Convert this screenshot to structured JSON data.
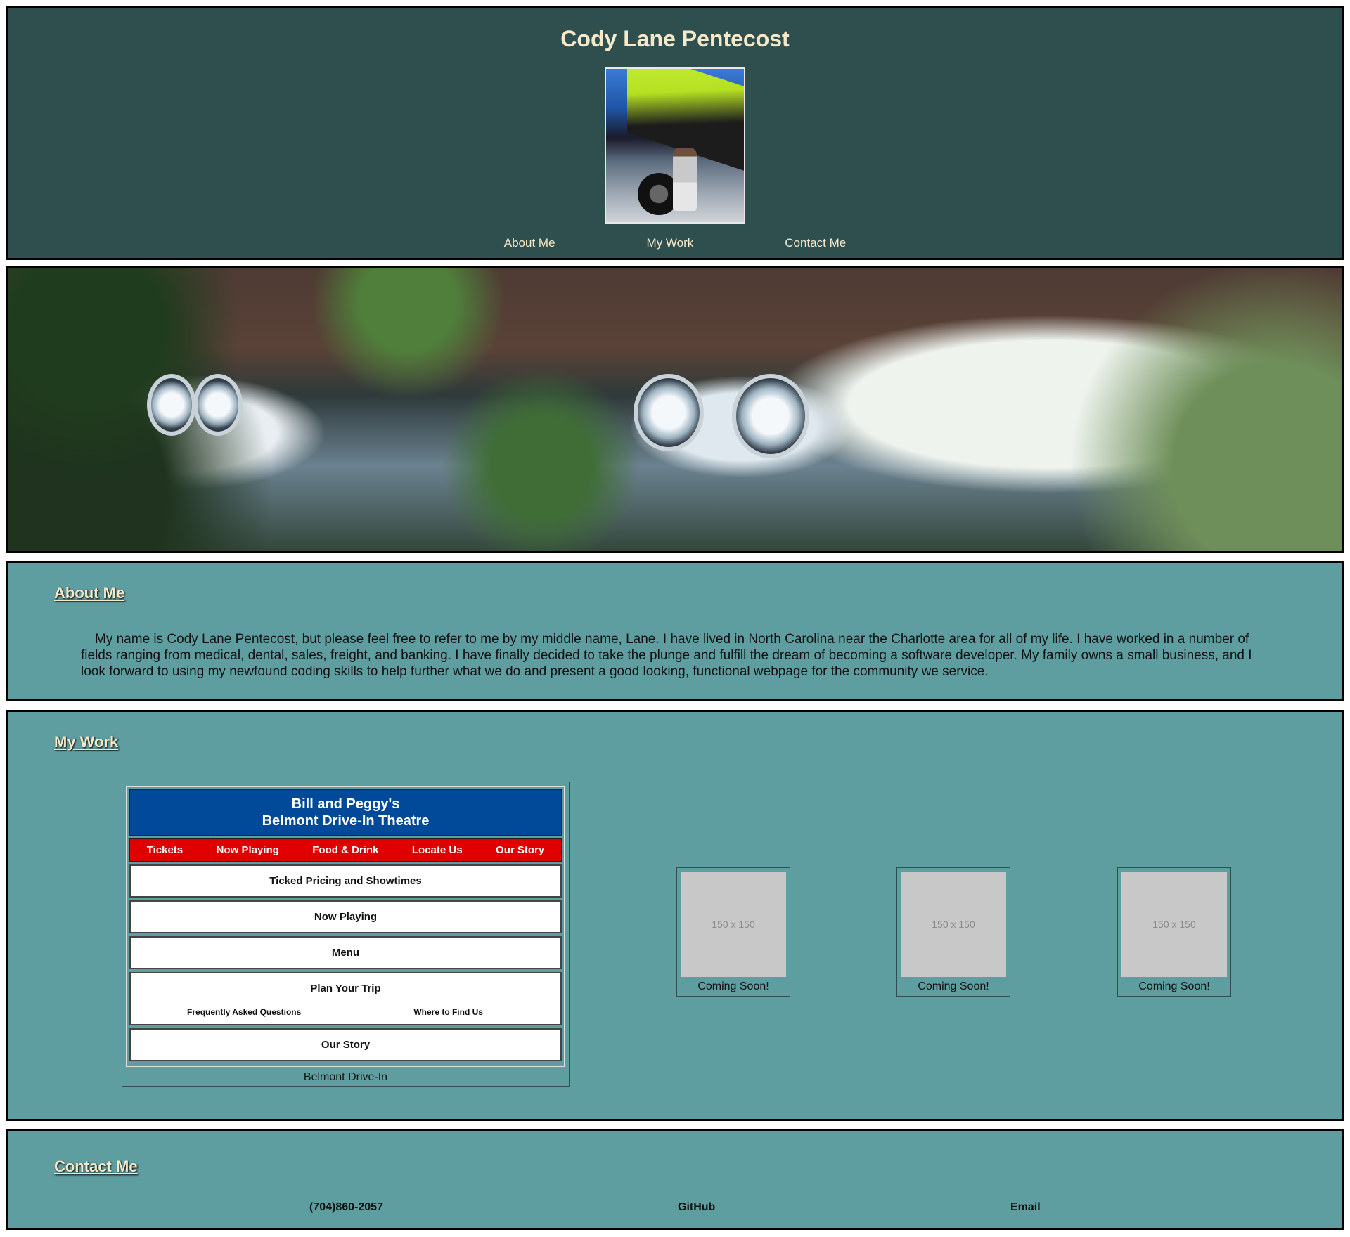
{
  "header": {
    "title": "Cody Lane Pentecost",
    "nav": [
      "About Me",
      "My Work",
      "Contact Me"
    ]
  },
  "about": {
    "heading": "About Me",
    "body": "My name is Cody Lane Pentecost, but please feel free to refer to me by my middle name, Lane. I have lived in North Carolina near the Charlotte area for all of my life. I have worked in a number of fields ranging from medical, dental, sales, freight, and banking. I have finally decided to take the plunge and fulfill the dream of becoming a software developer. My family owns a small business, and I look forward to using my newfound coding skills to help further what we do and present a good looking, functional webpage for the community we service."
  },
  "work": {
    "heading": "My Work",
    "project": {
      "title_line1": "Bill and Peggy's",
      "title_line2": "Belmont Drive-In Theatre",
      "nav": [
        "Tickets",
        "Now Playing",
        "Food & Drink",
        "Locate Us",
        "Our Story"
      ],
      "boxes": [
        "Ticked Pricing and Showtimes",
        "Now Playing",
        "Menu",
        "Plan Your Trip",
        "Our Story"
      ],
      "sub_links": [
        "Frequently Asked Questions",
        "Where to Find Us"
      ],
      "caption": "Belmont Drive-In"
    },
    "placeholders": [
      {
        "label": "150 x 150",
        "caption": "Coming Soon!"
      },
      {
        "label": "150 x 150",
        "caption": "Coming Soon!"
      },
      {
        "label": "150 x 150",
        "caption": "Coming Soon!"
      }
    ]
  },
  "contact": {
    "heading": "Contact Me",
    "items": [
      "(704)860-2057",
      "GitHub",
      "Email"
    ]
  },
  "colors": {
    "header_bg": "#2f4f4f",
    "section_bg": "#5f9ea0",
    "title_text": "#f5e9c9",
    "site_blue": "#004a99",
    "site_red": "#e00000"
  }
}
